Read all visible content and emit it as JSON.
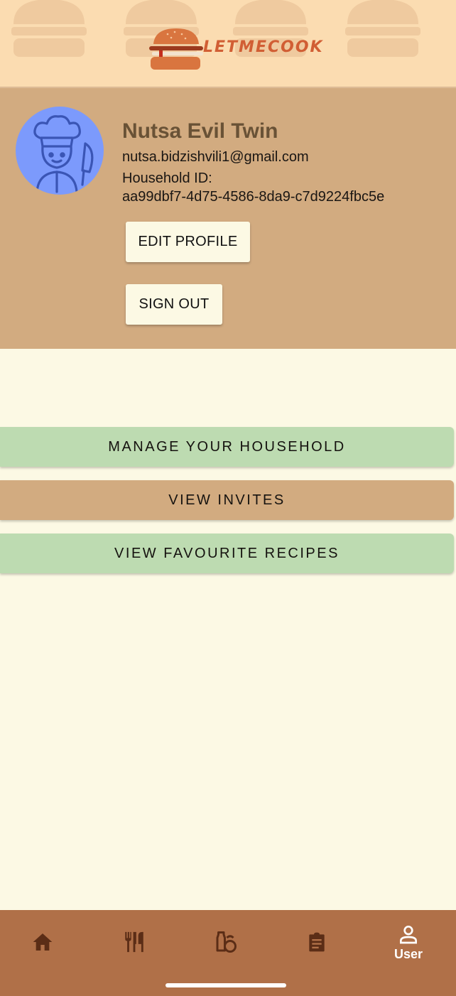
{
  "header": {
    "logo_text": "LETMECOOK"
  },
  "profile": {
    "name": "Nutsa Evil Twin",
    "email": "nutsa.bidzishvili1@gmail.com",
    "household_label": "Household ID:",
    "household_id": "aa99dbf7-4d75-4586-8da9-c7d9224fbc5e",
    "edit_button": "EDIT PROFILE",
    "signout_button": "SIGN OUT",
    "avatar_icon": "chef-avatar-icon"
  },
  "actions": {
    "manage_household": "MANAGE YOUR HOUSEHOLD",
    "view_invites": "VIEW INVITES",
    "view_favourites": "VIEW FAVOURITE RECIPES"
  },
  "nav": {
    "items": [
      {
        "icon": "home-icon",
        "label": ""
      },
      {
        "icon": "utensils-icon",
        "label": ""
      },
      {
        "icon": "pantry-icon",
        "label": ""
      },
      {
        "icon": "clipboard-icon",
        "label": ""
      },
      {
        "icon": "user-icon",
        "label": "User"
      }
    ]
  },
  "colors": {
    "header_bg": "#fbdcb1",
    "profile_bg": "#d2ab80",
    "page_bg": "#fcf9e4",
    "green_bar": "#bddbb1",
    "tan_bar": "#d2ab80",
    "nav_bg": "#b07048",
    "nav_icon": "#5b2d16",
    "logo_accent": "#d15e34",
    "avatar_bg": "#7c9afc"
  }
}
